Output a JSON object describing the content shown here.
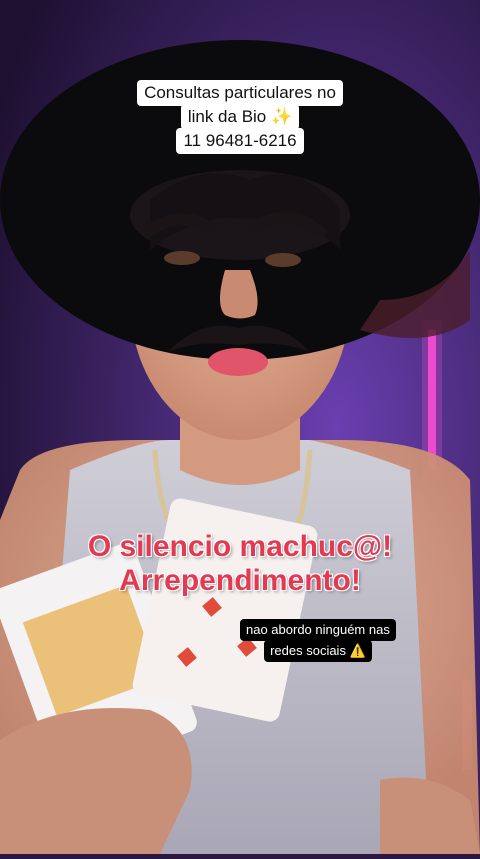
{
  "overlay": {
    "top_caption": [
      "Consultas particulares no",
      "link da Bio ✨",
      "11 96481-6216"
    ],
    "headline": [
      "O silencio machuc@!",
      "Arrependimento!"
    ],
    "note": [
      "nao abordo ninguém nas",
      "redes sociais ⚠️"
    ]
  },
  "colors": {
    "headline": "#e23a52",
    "background": "#2b1840",
    "led_strip": "#ff4fd8"
  }
}
